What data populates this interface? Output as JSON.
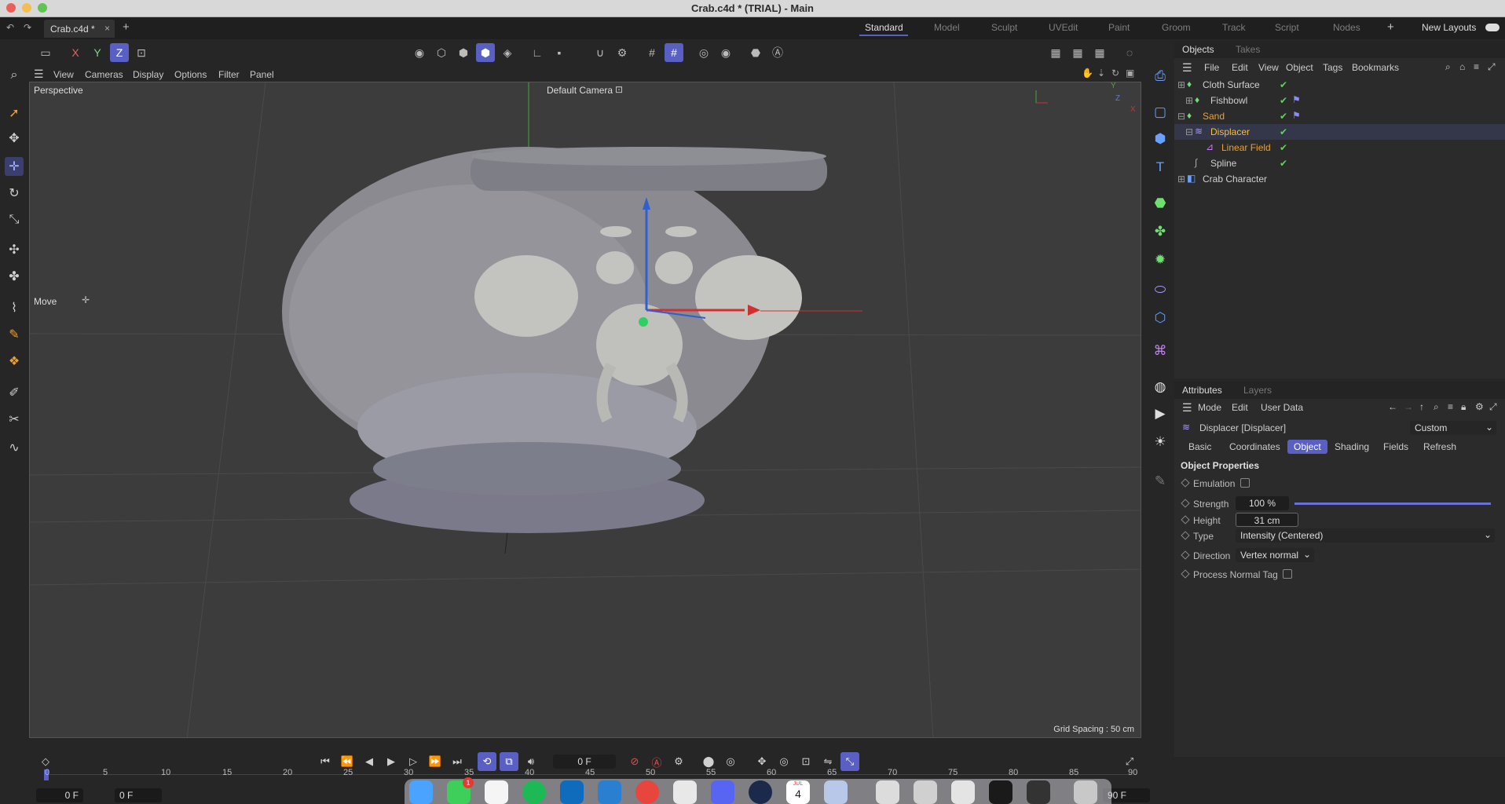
{
  "window": {
    "title": "Crab.c4d * (TRIAL) - Main",
    "doc_tab": "Crab.c4d *"
  },
  "layouts": {
    "items": [
      "Standard",
      "Model",
      "Sculpt",
      "UVEdit",
      "Paint",
      "Groom",
      "Track",
      "Script",
      "Nodes"
    ],
    "active": "Standard",
    "new_layouts": "New Layouts"
  },
  "axis_buttons": {
    "x": "X",
    "y": "Y",
    "z": "Z"
  },
  "viewport": {
    "menu": [
      "View",
      "Cameras",
      "Display",
      "Options",
      "Filter",
      "Panel"
    ],
    "label": "Perspective",
    "camera": "Default Camera",
    "tool_label": "Move",
    "grid_spacing": "Grid Spacing : 50 cm",
    "axis_x": "X",
    "axis_y": "Y",
    "axis_z": "Z"
  },
  "objects_panel": {
    "tabs": [
      "Objects",
      "Takes"
    ],
    "menu": [
      "File",
      "Edit",
      "View",
      "Object",
      "Tags",
      "Bookmarks"
    ],
    "items": [
      {
        "name": "Cloth Surface",
        "color": "#cfcfcf",
        "check": true
      },
      {
        "name": "Fishbowl",
        "color": "#cfcfcf",
        "check": true
      },
      {
        "name": "Sand",
        "color": "#e8a13a",
        "check": true
      },
      {
        "name": "Displacer",
        "color": "#f0c040",
        "check": true
      },
      {
        "name": "Linear Field",
        "color": "#e8a13a",
        "check": true
      },
      {
        "name": "Spline",
        "color": "#cfcfcf",
        "check": true
      },
      {
        "name": "Crab Character",
        "color": "#cfcfcf",
        "check": false
      }
    ]
  },
  "attributes_panel": {
    "tabs": [
      "Attributes",
      "Layers"
    ],
    "menu": [
      "Mode",
      "Edit",
      "User Data"
    ],
    "object_name": "Displacer [Displacer]",
    "preset": "Custom",
    "subtabs": [
      "Basic",
      "Coordinates",
      "Object",
      "Shading",
      "Fields",
      "Refresh"
    ],
    "active_subtab": "Object",
    "section": "Object Properties",
    "props": {
      "emulation": "Emulation",
      "strength_label": "Strength",
      "strength_value": "100 %",
      "strength_level": 1.0,
      "height_label": "Height",
      "height_value": "31 cm",
      "type_label": "Type",
      "type_value": "Intensity (Centered)",
      "direction_label": "Direction",
      "direction_value": "Vertex normal",
      "process_normal": "Process Normal Tag"
    }
  },
  "timeline": {
    "frame": "0 F",
    "start": "0 F",
    "start2": "0 F",
    "end": "90 F",
    "ruler": [
      "0",
      "5",
      "10",
      "15",
      "20",
      "25",
      "30",
      "35",
      "40",
      "45",
      "50",
      "55",
      "60",
      "65",
      "70",
      "75",
      "80",
      "85",
      "90"
    ]
  },
  "dock": {
    "calendar_month": "JUL",
    "calendar_day": "4",
    "badge": "1"
  },
  "colors": {
    "accent": "#5a5fc4",
    "viewport_bg": "#3c3c3c",
    "mesh": "#8d8d92"
  }
}
